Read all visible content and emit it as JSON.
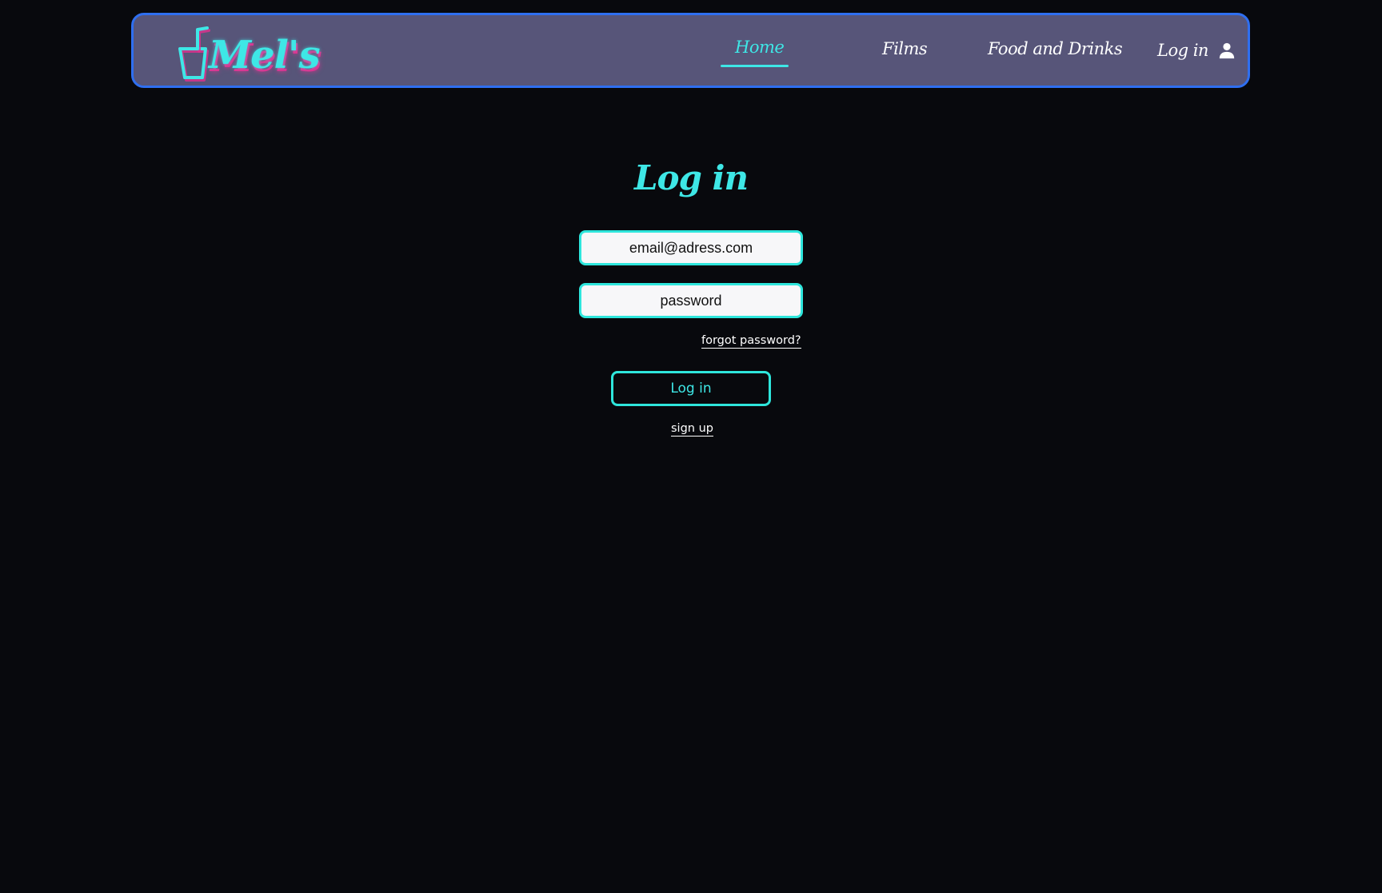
{
  "brand": {
    "name": "Mel's",
    "accent_color": "#3ee7e6",
    "shadow_color": "#e0318f",
    "logo_icon": "cup-icon"
  },
  "nav": {
    "items": [
      {
        "label": "Home",
        "active": true
      },
      {
        "label": "Films",
        "active": false
      },
      {
        "label": "Food and Drinks",
        "active": false
      },
      {
        "label": "Log in",
        "icon": "user-icon",
        "active": false
      }
    ],
    "background_color": "#575579",
    "border_color": "#2f6ff0"
  },
  "login": {
    "title": "Log in",
    "email_placeholder": "email@adress.com",
    "password_placeholder": "password",
    "forgot_label": "forgot password?",
    "submit_label": "Log in",
    "signup_label": "sign up"
  }
}
